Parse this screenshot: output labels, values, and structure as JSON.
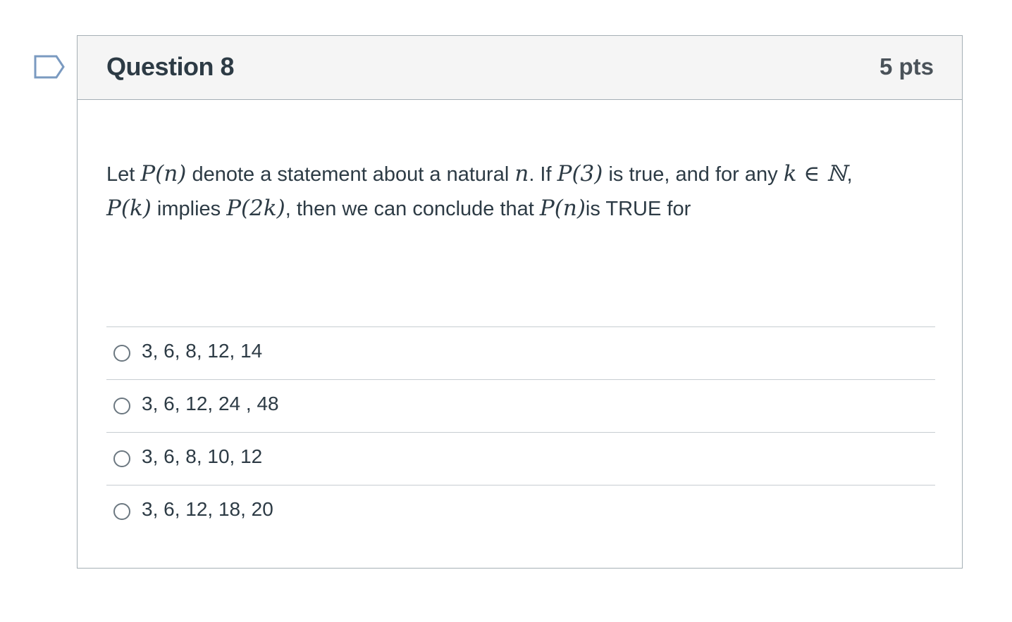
{
  "question": {
    "title": "Question 8",
    "points": "5 pts",
    "text": {
      "t1": "Let ",
      "m1": "P(n)",
      "t2": " denote a statement about a natural ",
      "m2": "n",
      "t3": ". If ",
      "m3": "P(3)",
      "t4": " is true, and for any ",
      "m4": "k ∈ ℕ",
      "t5": ",",
      "m5": "P(k)",
      "t6": " implies ",
      "m6": "P(2k)",
      "t7": ", then we can conclude that ",
      "m7": "P(n)",
      "t8": "is TRUE for"
    }
  },
  "answers": [
    {
      "label": "3, 6, 8, 12, 14"
    },
    {
      "label": "3, 6, 12, 24 , 48"
    },
    {
      "label": "3, 6, 8, 10, 12"
    },
    {
      "label": "3, 6, 12, 18, 20"
    }
  ],
  "colors": {
    "flag": "#7a9ac0",
    "header_bg": "#f5f5f5",
    "border": "#a5afb5",
    "text": "#2d3b45"
  },
  "icons": {
    "flag": "flag-outline-icon",
    "radio": "radio-unselected-icon"
  }
}
